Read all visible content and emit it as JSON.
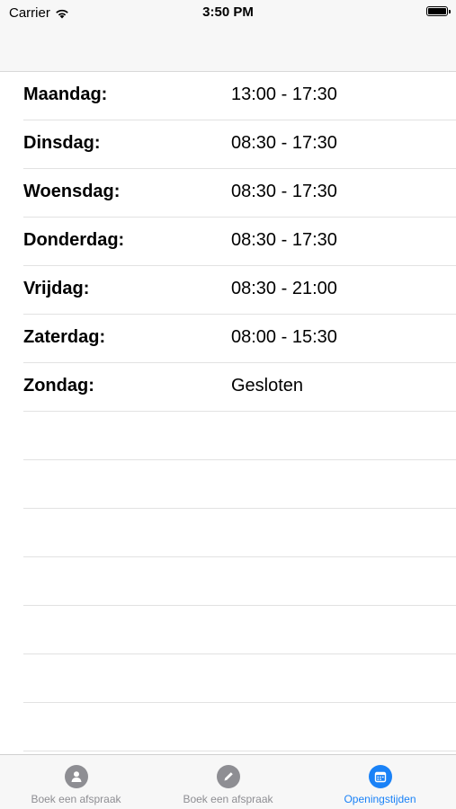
{
  "status_bar": {
    "carrier": "Carrier",
    "time": "3:50 PM"
  },
  "schedule": [
    {
      "day": "Maandag:",
      "hours": "13:00 - 17:30"
    },
    {
      "day": "Dinsdag:",
      "hours": "08:30 - 17:30"
    },
    {
      "day": "Woensdag:",
      "hours": "08:30 - 17:30"
    },
    {
      "day": "Donderdag:",
      "hours": "08:30 - 17:30"
    },
    {
      "day": "Vrijdag:",
      "hours": "08:30 - 21:00"
    },
    {
      "day": "Zaterdag:",
      "hours": "08:00 - 15:30"
    },
    {
      "day": "Zondag:",
      "hours": "Gesloten"
    }
  ],
  "tabs": [
    {
      "label": "Boek een afspraak",
      "icon": "person-icon",
      "active": false
    },
    {
      "label": "Boek een afspraak",
      "icon": "pencil-icon",
      "active": false
    },
    {
      "label": "Openingstijden",
      "icon": "calendar-icon",
      "active": true
    }
  ],
  "colors": {
    "accent": "#1a82f7",
    "inactive": "#8e8e93"
  }
}
